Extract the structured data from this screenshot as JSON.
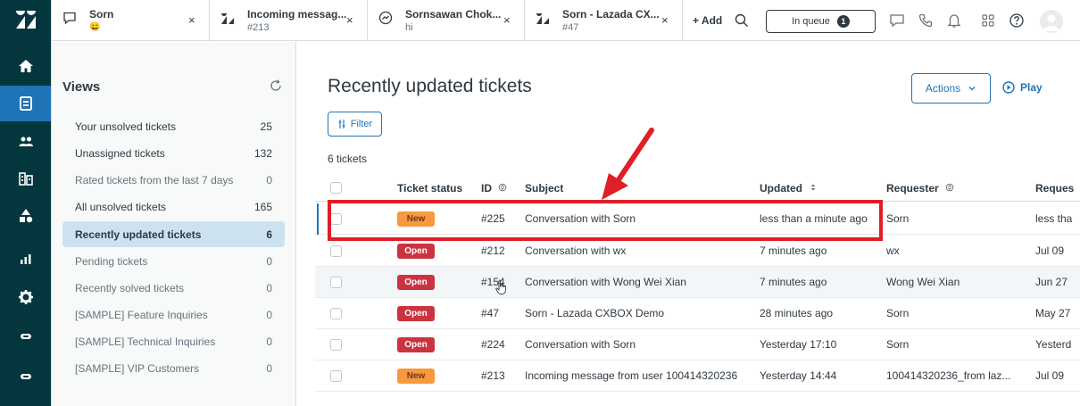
{
  "colors": {
    "nav_bg": "#03363d",
    "accent": "#1f73b7",
    "active_view": "#cde2f0",
    "new_badge": "#f79a3e",
    "open_badge": "#cc3340",
    "annotation": "#e01e26"
  },
  "nav": {
    "items": [
      {
        "icon": "home-icon"
      },
      {
        "icon": "views-icon",
        "active": true
      },
      {
        "icon": "customers-icon"
      },
      {
        "icon": "organizations-icon"
      },
      {
        "icon": "reporting-shapes-icon"
      },
      {
        "icon": "bar-chart-icon"
      },
      {
        "icon": "settings-gear-icon"
      },
      {
        "icon": "app-icon"
      },
      {
        "icon": "app-icon"
      }
    ]
  },
  "tabs": [
    {
      "title": "Sorn",
      "subtitle": "😀",
      "icon": "chat-icon"
    },
    {
      "title": "Incoming messag...",
      "subtitle": "#213",
      "icon": "lazada-icon"
    },
    {
      "title": "Sornsawan Chok...",
      "subtitle": "hi",
      "icon": "messenger-icon"
    },
    {
      "title": "Sorn - Lazada CX...",
      "subtitle": "#47",
      "icon": "lazada-icon"
    }
  ],
  "tabbar": {
    "close": "×",
    "add_label": "+ Add",
    "inqueue_label": "In queue",
    "inqueue_count": "1"
  },
  "views": {
    "title": "Views",
    "items": [
      {
        "label": "Your unsolved tickets",
        "count": "25"
      },
      {
        "label": "Unassigned tickets",
        "count": "132"
      },
      {
        "label": "Rated tickets from the last 7 days",
        "count": "0"
      },
      {
        "label": "All unsolved tickets",
        "count": "165"
      },
      {
        "label": "Recently updated tickets",
        "count": "6",
        "active": true
      },
      {
        "label": "Pending tickets",
        "count": "0"
      },
      {
        "label": "Recently solved tickets",
        "count": "0"
      },
      {
        "label": "[SAMPLE] Feature Inquiries",
        "count": "0"
      },
      {
        "label": "[SAMPLE] Technical Inquiries",
        "count": "0"
      },
      {
        "label": "[SAMPLE] VIP Customers",
        "count": "0"
      }
    ]
  },
  "main": {
    "title": "Recently updated tickets",
    "actions_label": "Actions",
    "play_label": "Play",
    "filter_label": "Filter",
    "count_label": "6 tickets",
    "columns": [
      "Ticket status",
      "ID",
      "Subject",
      "Updated",
      "Requester",
      "Reques"
    ],
    "rows": [
      {
        "status": "New",
        "id": "#225",
        "subject": "Conversation with Sorn",
        "updated": "less than a minute ago",
        "requester": "Sorn",
        "request_date": "less tha"
      },
      {
        "status": "Open",
        "id": "#212",
        "subject": "Conversation with wx",
        "updated": "7 minutes ago",
        "requester": "wx",
        "request_date": "Jul 09"
      },
      {
        "status": "Open",
        "id": "#154",
        "subject": "Conversation with Wong Wei Xian",
        "updated": "7 minutes ago",
        "requester": "Wong Wei Xian",
        "request_date": "Jun 27"
      },
      {
        "status": "Open",
        "id": "#47",
        "subject": "Sorn - Lazada CXBOX Demo",
        "updated": "28 minutes ago",
        "requester": "Sorn",
        "request_date": "May 27"
      },
      {
        "status": "Open",
        "id": "#224",
        "subject": "Conversation with Sorn",
        "updated": "Yesterday 17:10",
        "requester": "Sorn",
        "request_date": "Yesterd"
      },
      {
        "status": "New",
        "id": "#213",
        "subject": "Incoming message from user 100414320236",
        "updated": "Yesterday 14:44",
        "requester": "100414320236_from laz...",
        "request_date": "Jul 09"
      }
    ]
  }
}
